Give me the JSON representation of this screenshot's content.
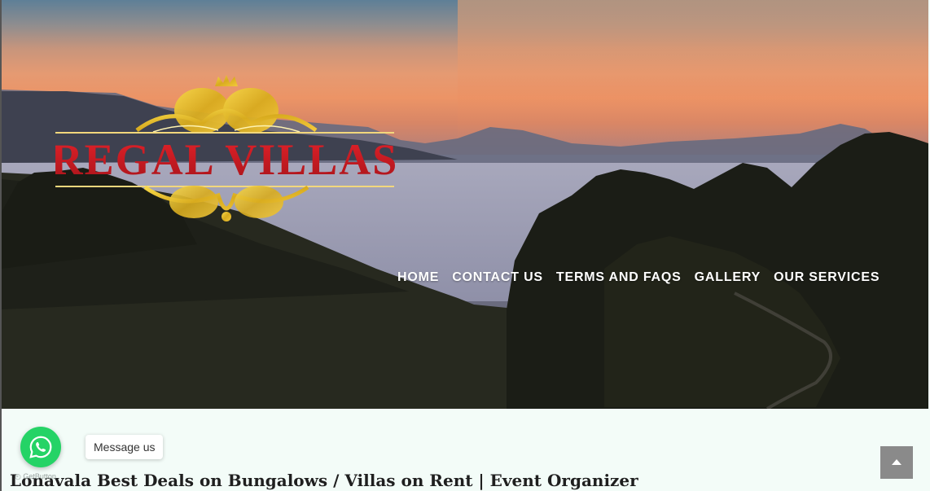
{
  "header": {
    "logo_text": "REGAL VILLAS"
  },
  "nav": {
    "items": [
      {
        "label": "HOME"
      },
      {
        "label": "CONTACT US"
      },
      {
        "label": "TERMS AND FAQS"
      },
      {
        "label": "GALLERY"
      },
      {
        "label": "OUR SERVICES"
      }
    ]
  },
  "main": {
    "headline": "Lonavala Best Deals on Bungalows / Villas on Rent | Event Organizer"
  },
  "chat_widget": {
    "tooltip": "Message us",
    "credit": "GetButton",
    "icon": "whatsapp-icon",
    "color": "#25d366"
  },
  "scroll_top": {
    "icon": "chevron-up-icon",
    "color": "#8a8a8a"
  }
}
